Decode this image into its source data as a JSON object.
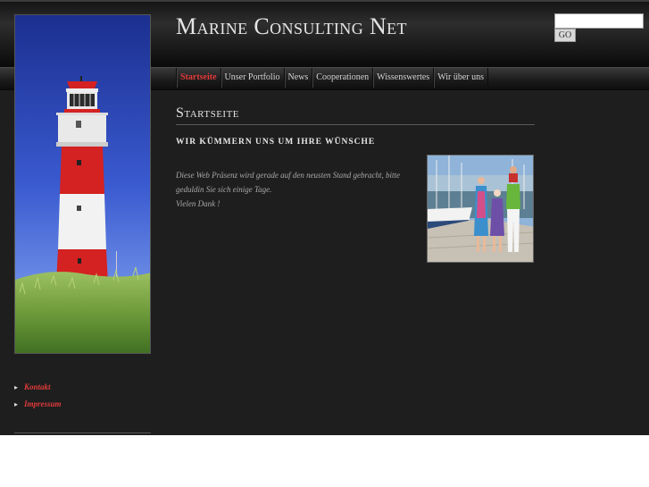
{
  "header": {
    "site_title": "Marine Consulting Net",
    "search": {
      "value": "",
      "placeholder": "",
      "button_label": "GO"
    }
  },
  "nav": {
    "items": [
      {
        "label": "Startseite",
        "active": true
      },
      {
        "label": "Unser Portfolio",
        "active": false
      },
      {
        "label": "News",
        "active": false
      },
      {
        "label": "Cooperationen",
        "active": false
      },
      {
        "label": "Wissenswertes",
        "active": false
      },
      {
        "label": "Wir über uns",
        "active": false
      }
    ]
  },
  "sidebar": {
    "links": [
      {
        "label": "Kontakt"
      },
      {
        "label": "Impressum"
      }
    ]
  },
  "main": {
    "section_title": "Startseite",
    "subheading": "WIR KÜMMERN UNS UM IHRE WÜNSCHE",
    "intro_line1": "Diese Web Präsenz wird gerade auf den neusten Stand gebracht, bitte geduldin Sie sich einige Tage.",
    "intro_line2": "Vielen Dank !"
  },
  "colors": {
    "accent_red": "#e33b3b",
    "page_background": "#1e1e1e",
    "text_light": "#e4e4e4"
  }
}
